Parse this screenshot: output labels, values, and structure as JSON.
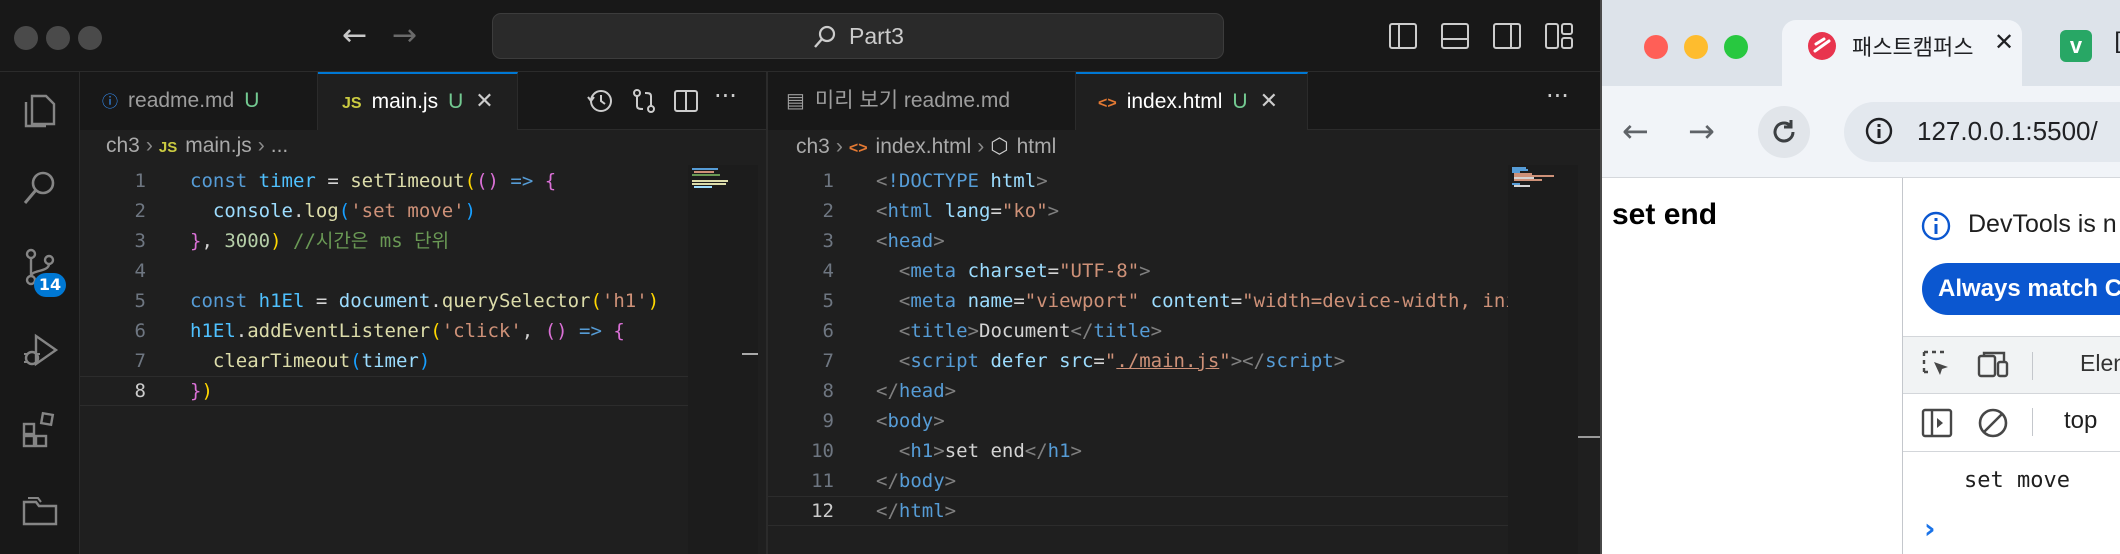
{
  "vscode": {
    "command_center": "Part3",
    "left_editor": {
      "tabs": [
        {
          "icon": "ⓘ",
          "label": "readme.md",
          "status": "U"
        },
        {
          "icon": "JS",
          "label": "main.js",
          "status": "U",
          "close": "✕"
        }
      ],
      "breadcrumb": {
        "folder": "ch3",
        "file_icon": "JS",
        "file": "main.js",
        "more": "..."
      },
      "line_numbers": [
        "1",
        "2",
        "3",
        "4",
        "5",
        "6",
        "7",
        "8"
      ]
    },
    "right_editor": {
      "tabs": [
        {
          "icon": "▤",
          "label": "미리 보기 readme.md"
        },
        {
          "icon": "<>",
          "label": "index.html",
          "status": "U",
          "close": "✕"
        }
      ],
      "breadcrumb": {
        "folder": "ch3",
        "file_icon": "<>",
        "file": "index.html",
        "symbol": "html"
      },
      "line_numbers": [
        "1",
        "2",
        "3",
        "4",
        "5",
        "6",
        "7",
        "8",
        "9",
        "10",
        "11",
        "12"
      ]
    },
    "scm_badge": "14",
    "more_actions": "···"
  },
  "browser": {
    "tab_title": "패스트캠퍼스",
    "tab_close": "✕",
    "second_tab_icon": "v",
    "second_tab_partial": "[",
    "url": "127.0.0.1:5500/",
    "page_heading": "set end",
    "devtools": {
      "info_text": "DevTools is n",
      "match_button": "Always match C",
      "elements_tab": "Elen",
      "context": "top",
      "console_log": "set move",
      "prompt": "›"
    }
  }
}
